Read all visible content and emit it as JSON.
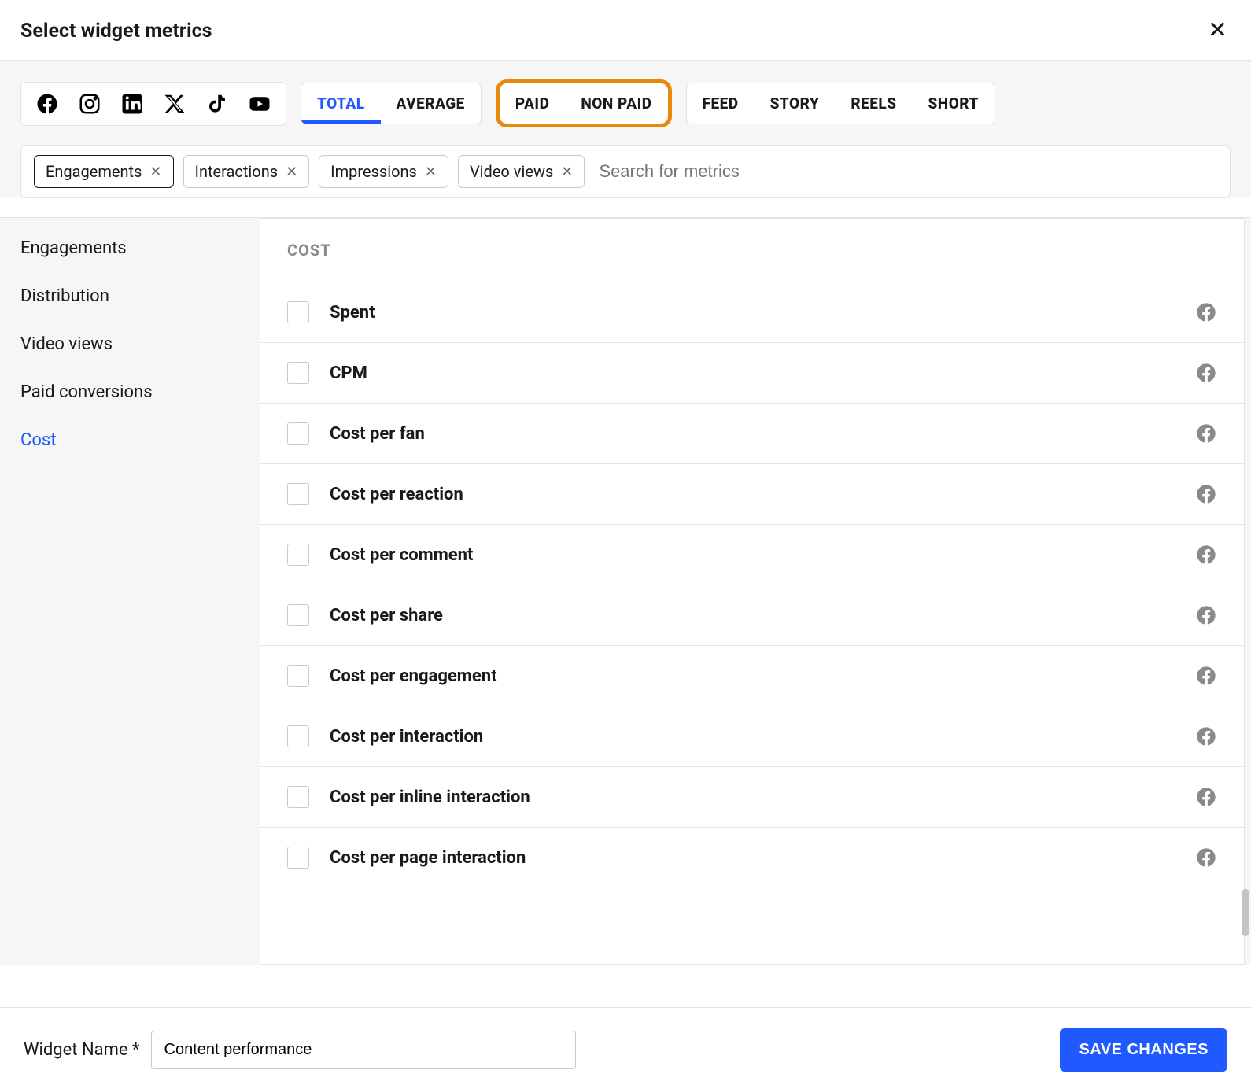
{
  "header": {
    "title": "Select widget metrics"
  },
  "socials": [
    "facebook",
    "instagram",
    "linkedin",
    "x",
    "tiktok",
    "youtube"
  ],
  "segments": {
    "group1": [
      {
        "label": "TOTAL",
        "active": true
      },
      {
        "label": "AVERAGE",
        "active": false
      }
    ],
    "group2": [
      {
        "label": "PAID"
      },
      {
        "label": "NON PAID"
      }
    ],
    "group3": [
      {
        "label": "FEED"
      },
      {
        "label": "STORY"
      },
      {
        "label": "REELS"
      },
      {
        "label": "SHORT"
      }
    ]
  },
  "chips": [
    {
      "label": "Engagements",
      "selected": true
    },
    {
      "label": "Interactions",
      "selected": false
    },
    {
      "label": "Impressions",
      "selected": false
    },
    {
      "label": "Video views",
      "selected": false
    }
  ],
  "search": {
    "placeholder": "Search for metrics"
  },
  "sidebar": {
    "items": [
      {
        "label": "Engagements",
        "active": false
      },
      {
        "label": "Distribution",
        "active": false
      },
      {
        "label": "Video views",
        "active": false
      },
      {
        "label": "Paid conversions",
        "active": false
      },
      {
        "label": "Cost",
        "active": true
      }
    ]
  },
  "section": {
    "title": "COST",
    "metrics": [
      {
        "label": "Spent",
        "platform": "facebook"
      },
      {
        "label": "CPM",
        "platform": "facebook"
      },
      {
        "label": "Cost per fan",
        "platform": "facebook"
      },
      {
        "label": "Cost per reaction",
        "platform": "facebook"
      },
      {
        "label": "Cost per comment",
        "platform": "facebook"
      },
      {
        "label": "Cost per share",
        "platform": "facebook"
      },
      {
        "label": "Cost per engagement",
        "platform": "facebook"
      },
      {
        "label": "Cost per interaction",
        "platform": "facebook"
      },
      {
        "label": "Cost per inline interaction",
        "platform": "facebook"
      },
      {
        "label": "Cost per page interaction",
        "platform": "facebook"
      }
    ]
  },
  "footer": {
    "label": "Widget Name *",
    "value": "Content performance",
    "save": "SAVE CHANGES"
  }
}
